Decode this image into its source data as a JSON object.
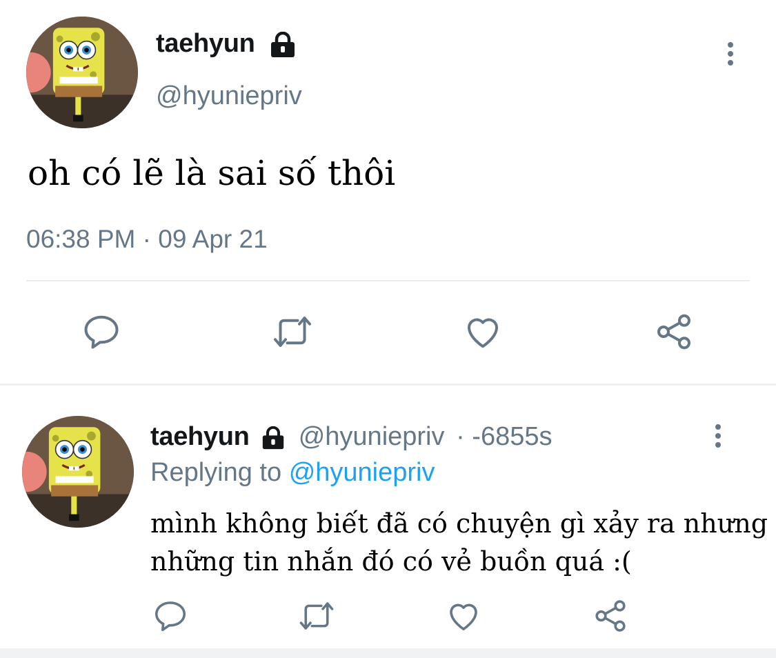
{
  "main_tweet": {
    "name": "taehyun",
    "handle": "@hyuniepriv",
    "text": "oh có lẽ là sai số thôi",
    "timestamp": "06:38 PM · 09 Apr 21",
    "avatar_icon": "spongebob-avatar",
    "actions": [
      "reply-icon",
      "retweet-icon",
      "like-icon",
      "share-icon"
    ]
  },
  "reply_tweet": {
    "name": "taehyun",
    "handle": "@hyuniepriv",
    "time": "· -6855s",
    "replying_label": "Replying to",
    "replying_mention": "@hyuniepriv",
    "text_line1": "mình không biết đã có chuyện gì xảy ra nhưng",
    "text_line2": "những tin nhắn đó có vẻ buồn quá :(",
    "avatar_icon": "spongebob-avatar",
    "actions": [
      "reply-icon",
      "retweet-icon",
      "like-icon",
      "share-icon"
    ]
  },
  "colors": {
    "primary_text": "#14171a",
    "secondary_text": "#657786",
    "link": "#1da1f2",
    "divider": "#e6ecf0"
  }
}
